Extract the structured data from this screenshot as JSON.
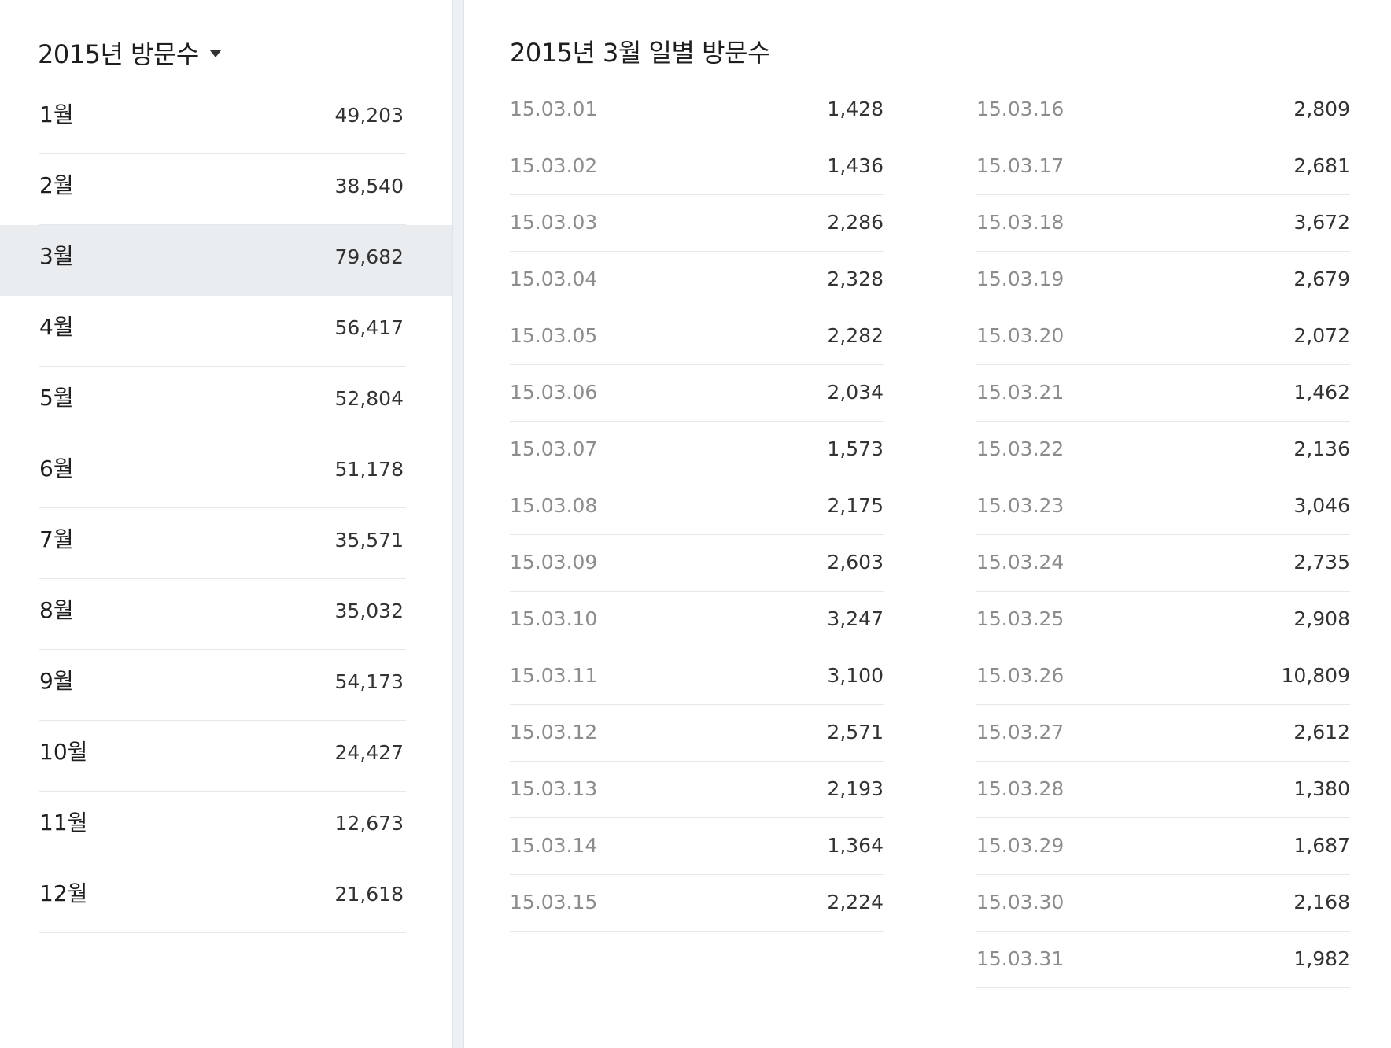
{
  "monthly": {
    "title": "2015년 방문수",
    "selected_index": 2,
    "months": [
      {
        "label": "1월",
        "count": "49,203"
      },
      {
        "label": "2월",
        "count": "38,540"
      },
      {
        "label": "3월",
        "count": "79,682"
      },
      {
        "label": "4월",
        "count": "56,417"
      },
      {
        "label": "5월",
        "count": "52,804"
      },
      {
        "label": "6월",
        "count": "51,178"
      },
      {
        "label": "7월",
        "count": "35,571"
      },
      {
        "label": "8월",
        "count": "35,032"
      },
      {
        "label": "9월",
        "count": "54,173"
      },
      {
        "label": "10월",
        "count": "24,427"
      },
      {
        "label": "11월",
        "count": "12,673"
      },
      {
        "label": "12월",
        "count": "21,618"
      }
    ]
  },
  "daily": {
    "title": "2015년 3월 일별 방문수",
    "column1": [
      {
        "date": "15.03.01",
        "count": "1,428"
      },
      {
        "date": "15.03.02",
        "count": "1,436"
      },
      {
        "date": "15.03.03",
        "count": "2,286"
      },
      {
        "date": "15.03.04",
        "count": "2,328"
      },
      {
        "date": "15.03.05",
        "count": "2,282"
      },
      {
        "date": "15.03.06",
        "count": "2,034"
      },
      {
        "date": "15.03.07",
        "count": "1,573"
      },
      {
        "date": "15.03.08",
        "count": "2,175"
      },
      {
        "date": "15.03.09",
        "count": "2,603"
      },
      {
        "date": "15.03.10",
        "count": "3,247"
      },
      {
        "date": "15.03.11",
        "count": "3,100"
      },
      {
        "date": "15.03.12",
        "count": "2,571"
      },
      {
        "date": "15.03.13",
        "count": "2,193"
      },
      {
        "date": "15.03.14",
        "count": "1,364"
      },
      {
        "date": "15.03.15",
        "count": "2,224"
      }
    ],
    "column2": [
      {
        "date": "15.03.16",
        "count": "2,809"
      },
      {
        "date": "15.03.17",
        "count": "2,681"
      },
      {
        "date": "15.03.18",
        "count": "3,672"
      },
      {
        "date": "15.03.19",
        "count": "2,679"
      },
      {
        "date": "15.03.20",
        "count": "2,072"
      },
      {
        "date": "15.03.21",
        "count": "1,462"
      },
      {
        "date": "15.03.22",
        "count": "2,136"
      },
      {
        "date": "15.03.23",
        "count": "3,046"
      },
      {
        "date": "15.03.24",
        "count": "2,735"
      },
      {
        "date": "15.03.25",
        "count": "2,908"
      },
      {
        "date": "15.03.26",
        "count": "10,809"
      },
      {
        "date": "15.03.27",
        "count": "2,612"
      },
      {
        "date": "15.03.28",
        "count": "1,380"
      },
      {
        "date": "15.03.29",
        "count": "1,687"
      },
      {
        "date": "15.03.30",
        "count": "2,168"
      },
      {
        "date": "15.03.31",
        "count": "1,982"
      }
    ]
  }
}
